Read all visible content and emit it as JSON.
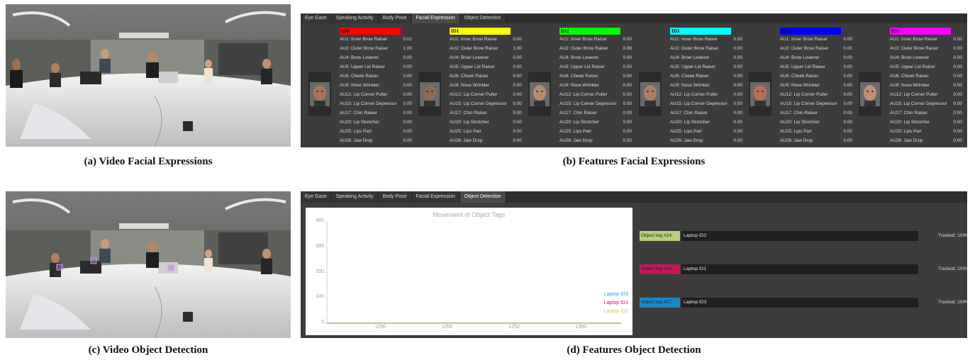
{
  "captions": {
    "a": "(a) Video Facial Expressions",
    "b": "(b) Features Facial Expressions",
    "c": "(c) Video Object Detection",
    "d": "(d) Features Object Detection"
  },
  "tabs": [
    "Eye Gaze",
    "Speaking Activity",
    "Body Pose",
    "Facial Expression",
    "Object Detection"
  ],
  "facial": {
    "active_tab": "Facial Expression",
    "au_labels": [
      "AU1: Inner Brow Raiser",
      "AU2: Outer Brow Raiser",
      "AU4: Brow Lowerer",
      "AU5: Upper Lid Raiser",
      "AU6: Cheek Raiser",
      "AU9: Nose Wrinkler",
      "AU12: Lip Corner Puller",
      "AU15: Lip Corner Depressor",
      "AU17: Chin Raiser",
      "AU20: Lip Stretcher",
      "AU25: Lips Part",
      "AU26: Jaw Drop"
    ],
    "ids": [
      {
        "label": "ID0",
        "color": "#ff0000",
        "values": [
          "0.01",
          "1.00",
          "0.00",
          "0.00",
          "0.00",
          "0.00",
          "0.00",
          "0.00",
          "0.00",
          "0.00",
          "0.00",
          "0.00"
        ]
      },
      {
        "label": "ID1",
        "color": "#ffff00",
        "values": [
          "0.00",
          "1.00",
          "0.00",
          "0.00",
          "0.00",
          "0.00",
          "0.00",
          "0.00",
          "0.00",
          "0.00",
          "0.00",
          "0.00"
        ]
      },
      {
        "label": "ID2",
        "color": "#00ff00",
        "values": [
          "0.00",
          "0.99",
          "0.00",
          "0.00",
          "0.00",
          "0.00",
          "0.00",
          "0.00",
          "0.00",
          "0.00",
          "0.00",
          "0.00"
        ]
      },
      {
        "label": "ID3",
        "color": "#00ffff",
        "values": [
          "0.00",
          "0.00",
          "0.00",
          "0.00",
          "0.00",
          "0.00",
          "0.00",
          "0.00",
          "0.00",
          "0.00",
          "0.00",
          "0.00"
        ]
      },
      {
        "label": "ID4",
        "color": "#0000ff",
        "values": [
          "0.00",
          "0.00",
          "0.00",
          "0.00",
          "0.00",
          "0.00",
          "0.00",
          "0.00",
          "0.00",
          "0.00",
          "0.00",
          "0.00"
        ]
      },
      {
        "label": "ID5",
        "color": "#ff00ff",
        "values": [
          "0.00",
          "0.00",
          "0.00",
          "0.00",
          "0.00",
          "0.00",
          "0.00",
          "0.00",
          "0.00",
          "0.00",
          "0.00",
          "0.00"
        ]
      }
    ]
  },
  "objects": {
    "active_tab": "Object Detection",
    "tags": [
      {
        "tag": "Object tag #14:",
        "name": "Laptop ID2",
        "tracked": "Tracked: 100%",
        "color": "#b7d07a"
      },
      {
        "tag": "Object tag #15:",
        "name": "Laptop ID1",
        "tracked": "Tracked: 100%",
        "color": "#c2185b"
      },
      {
        "tag": "Object tag #17:",
        "name": "Laptop ID3",
        "tracked": "Tracked: 100%",
        "color": "#1e88c8"
      }
    ]
  },
  "chart_data": {
    "type": "line",
    "title": "Movement of Object Tags",
    "xlabel": "",
    "ylabel": "",
    "xlim": [
      1110,
      1330
    ],
    "ylim": [
      0,
      400
    ],
    "xticks": [
      "1150",
      "1200",
      "1250",
      "1300"
    ],
    "yticks": [
      "0",
      "100",
      "200",
      "300",
      "400"
    ],
    "legend_position": "bottom-right",
    "series": [
      {
        "name": "Laptop ID3",
        "color": "#3b9ad9",
        "x": [
          1110,
          1330
        ],
        "y": [
          0,
          0
        ]
      },
      {
        "name": "Laptop ID1",
        "color": "#c2185b",
        "x": [
          1110,
          1330
        ],
        "y": [
          0,
          0
        ]
      },
      {
        "name": "Laptop ID2",
        "color": "#d4c56a",
        "x": [
          1110,
          1330
        ],
        "y": [
          0,
          0
        ]
      }
    ]
  }
}
